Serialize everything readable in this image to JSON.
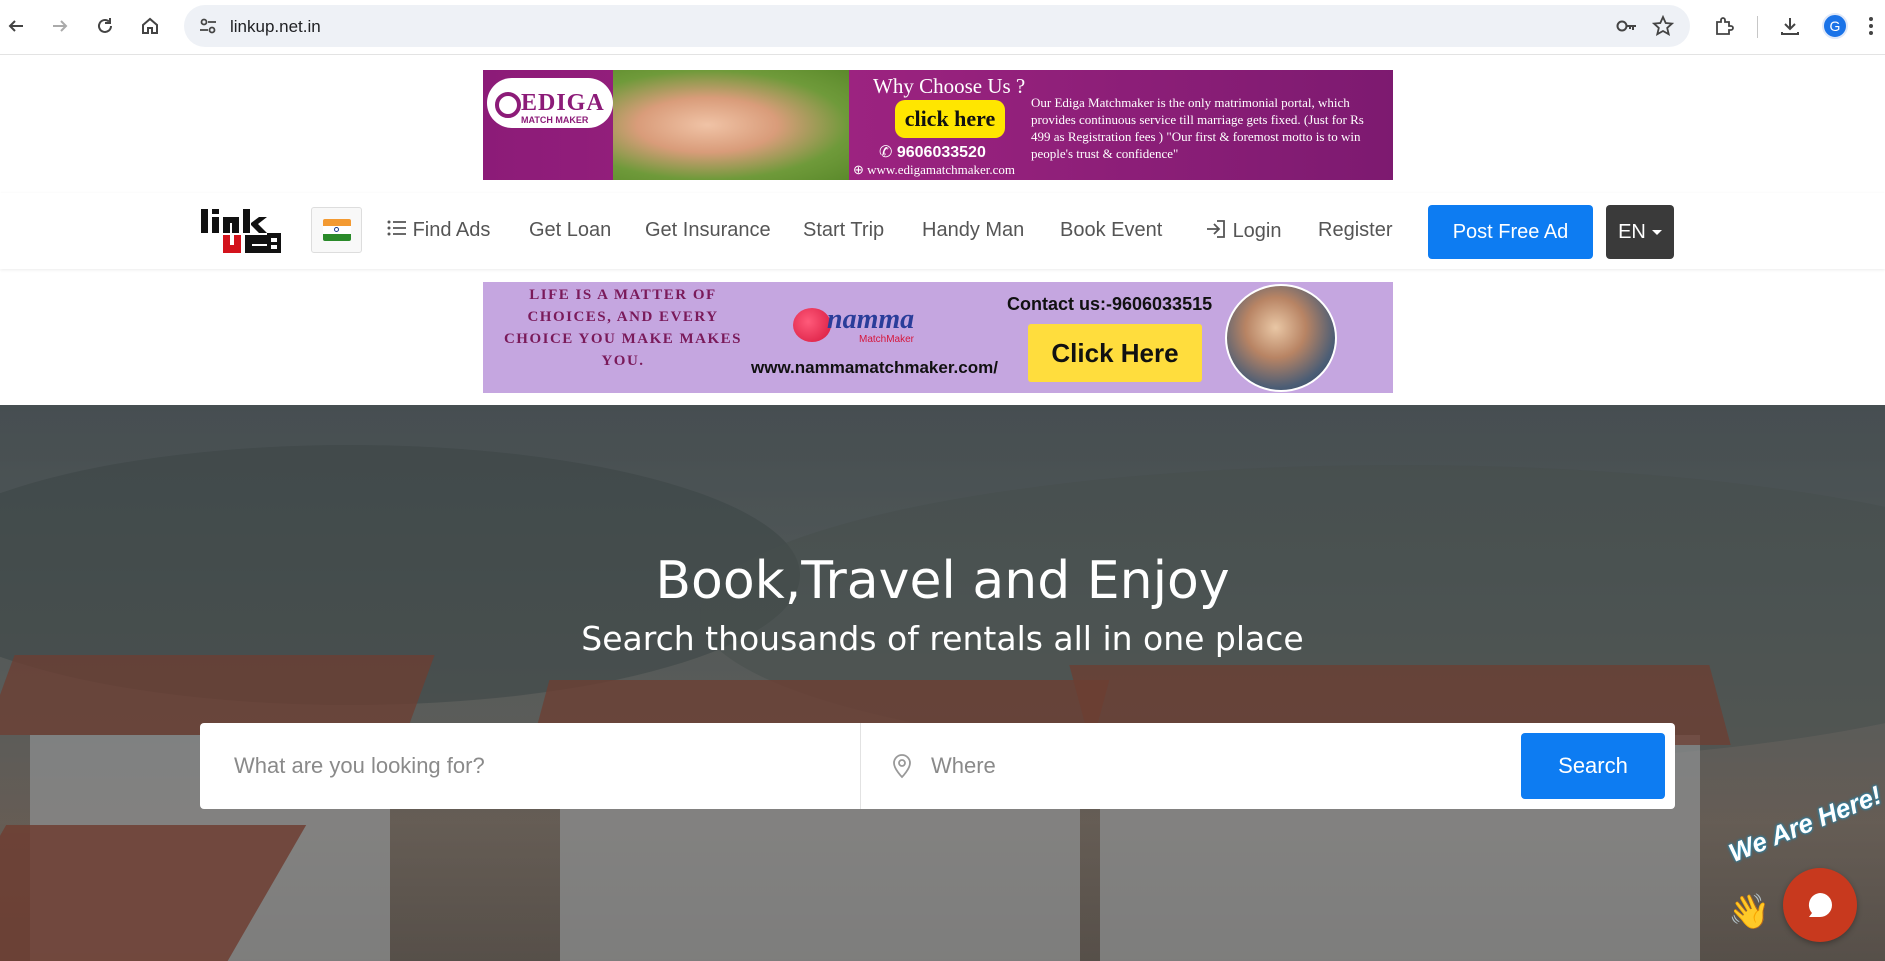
{
  "browser": {
    "url": "linkup.net.in",
    "profile_initial": "G"
  },
  "banner_top": {
    "logo_main": "EDIGA",
    "logo_sub": "MATCH MAKER",
    "heading": "Why Choose Us ?",
    "cta": "click here",
    "phone": "9606033520",
    "website": "www.edigamatchmaker.com",
    "description": "Our Ediga Matchmaker is the only matrimonial portal, which provides continuous service till marriage gets fixed. (Just for Rs 499 as Registration fees ) \"Our first & foremost motto is to win people's trust & confidence\""
  },
  "navbar": {
    "links": {
      "find_ads": "Find Ads",
      "get_loan": "Get Loan",
      "get_insurance": "Get Insurance",
      "start_trip": "Start Trip",
      "handy_man": "Handy Man",
      "book_event": "Book Event",
      "login": "Login",
      "register": "Register"
    },
    "post_ad": "Post Free Ad",
    "language": "EN"
  },
  "banner_second": {
    "quote": "LIFE IS A MATTER OF CHOICES, AND EVERY CHOICE YOU MAKE MAKES YOU.",
    "brand": "namma",
    "brand_sub": "MatchMaker",
    "website": "www.nammamatchmaker.com/",
    "contact": "Contact us:-9606033515",
    "cta": "Click Here"
  },
  "hero": {
    "title": "Book,Travel and Enjoy",
    "subtitle": "Search thousands of rentals all in one place",
    "search_what_placeholder": "What are you looking for?",
    "search_where_placeholder": "Where",
    "search_button": "Search"
  },
  "chat": {
    "label": "We Are Here!"
  },
  "colors": {
    "primary": "#0d7cf2",
    "dark": "#3a3a3a",
    "banner_magenta": "#8c1b78",
    "banner_lavender": "#c5a6e0",
    "chat_red": "#c8391e"
  }
}
